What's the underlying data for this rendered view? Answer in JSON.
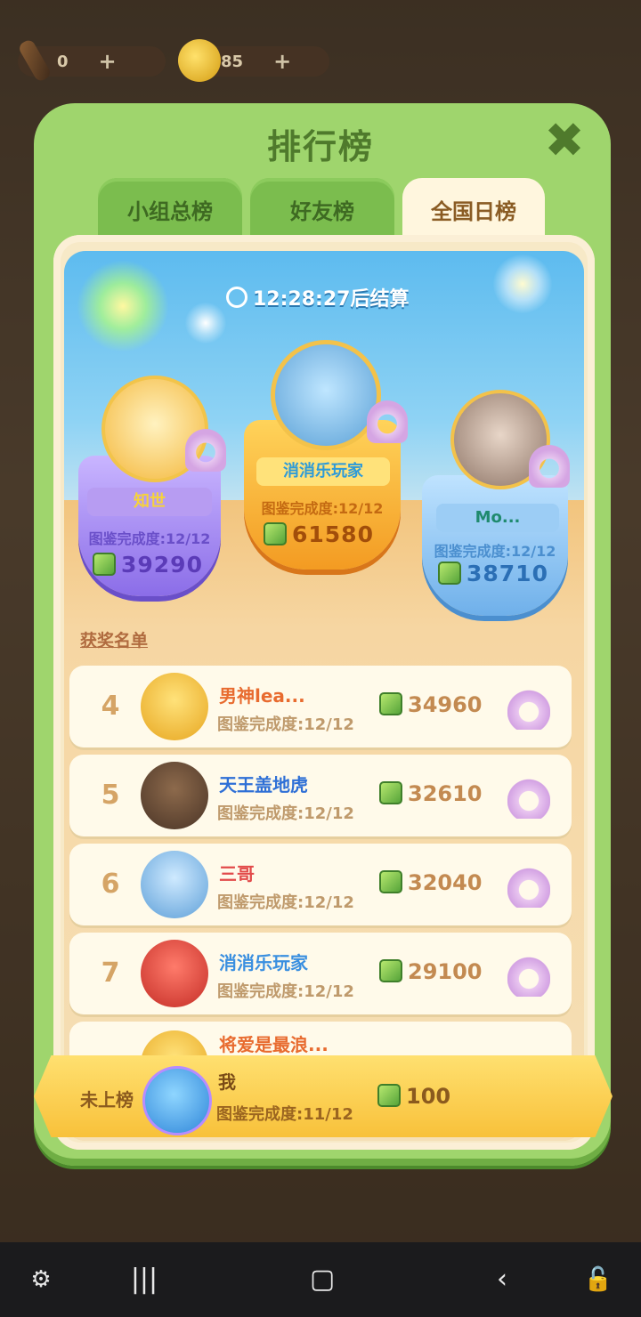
{
  "topbar": {
    "wand_count": "0",
    "coin_count": "85",
    "plus": "+"
  },
  "panel": {
    "title": "排行榜",
    "close": "✖",
    "tabs": [
      {
        "label": "小组总榜",
        "active": false
      },
      {
        "label": "好友榜",
        "active": false
      },
      {
        "label": "全国日榜",
        "active": true
      }
    ],
    "timer": "12:28:27后结算"
  },
  "podium": {
    "first": {
      "name": "消消乐玩家",
      "progress": "图鉴完成度:12/12",
      "score": "61580"
    },
    "second": {
      "name": "知世",
      "progress": "图鉴完成度:12/12",
      "score": "39290"
    },
    "third": {
      "name": "Mo...",
      "progress": "图鉴完成度:12/12",
      "score": "38710"
    }
  },
  "list": {
    "title": "获奖名单",
    "rows": [
      {
        "rank": "4",
        "name": "男神lea...",
        "progress": "图鉴完成度:12/12",
        "score": "34960",
        "name_color": "#e86b2f"
      },
      {
        "rank": "5",
        "name": "天王盖地虎",
        "progress": "图鉴完成度:12/12",
        "score": "32610",
        "name_color": "#2e6fd6"
      },
      {
        "rank": "6",
        "name": "三哥",
        "progress": "图鉴完成度:12/12",
        "score": "32040",
        "name_color": "#e24a4a"
      },
      {
        "rank": "7",
        "name": "消消乐玩家",
        "progress": "图鉴完成度:12/12",
        "score": "29100",
        "name_color": "#3a8fe0"
      },
      {
        "rank": "8",
        "name": "将爱是最浪...",
        "progress": "",
        "score": "",
        "name_color": "#e86b2f"
      }
    ]
  },
  "me": {
    "rank_label": "未上榜",
    "name": "我",
    "progress": "图鉴完成度:11/12",
    "score": "100"
  },
  "colors": {
    "panel_green": "#9fd56d",
    "title_green": "#4f7a2c",
    "gold": "#f8c13a",
    "cream": "#fffaea"
  }
}
